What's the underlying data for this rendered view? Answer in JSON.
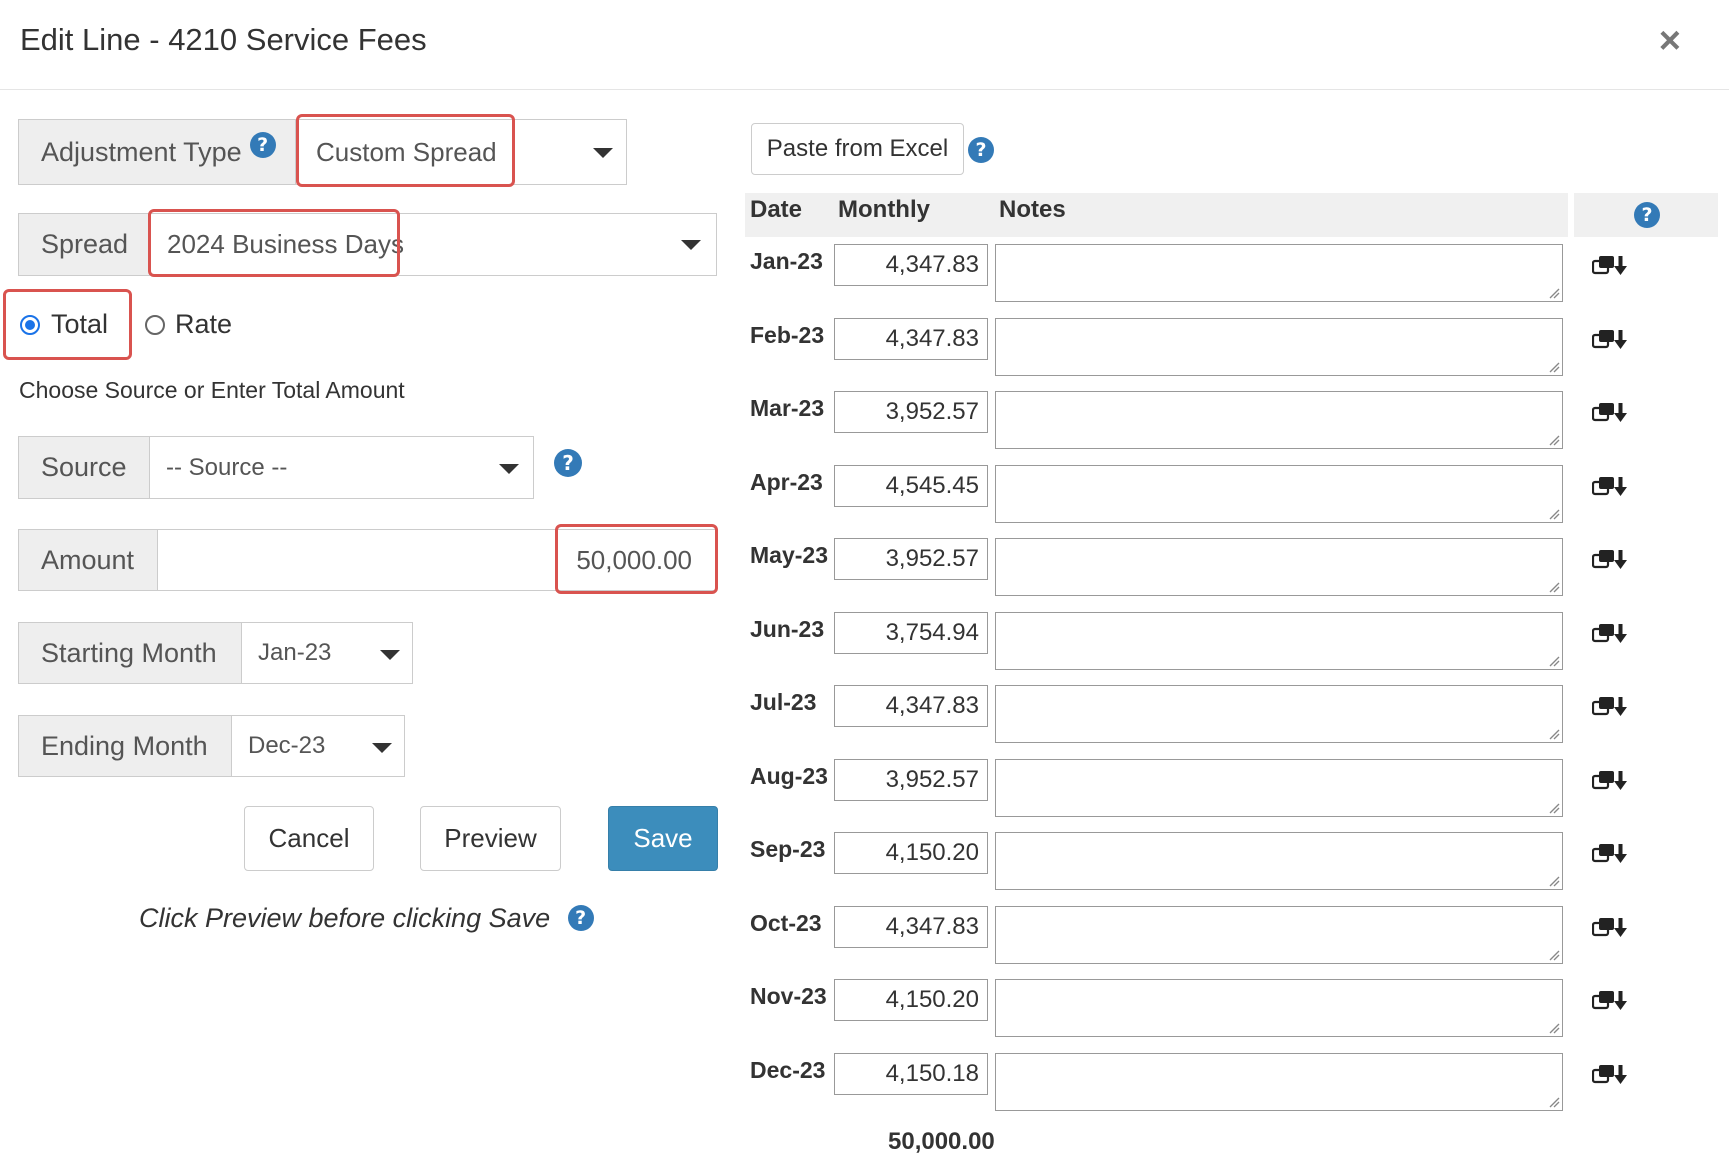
{
  "dialog": {
    "title": "Edit Line - 4210 Service Fees",
    "close": "×"
  },
  "form": {
    "adjustment_type_label": "Adjustment Type",
    "adjustment_type_value": "Custom Spread",
    "spread_label": "Spread",
    "spread_value": "2024 Business Days",
    "radio_total": "Total",
    "radio_rate": "Rate",
    "selected_mode": "Total",
    "hint": "Choose Source or Enter Total Amount",
    "source_label": "Source",
    "source_value": "-- Source --",
    "amount_label": "Amount",
    "amount_value": "50,000.00",
    "starting_month_label": "Starting Month",
    "starting_month_value": "Jan-23",
    "ending_month_label": "Ending Month",
    "ending_month_value": "Dec-23",
    "cancel": "Cancel",
    "preview": "Preview",
    "save": "Save",
    "note": "Click Preview before clicking Save"
  },
  "help_glyph": "?",
  "table": {
    "paste_button": "Paste from Excel",
    "headers": {
      "date": "Date",
      "monthly": "Monthly",
      "notes": "Notes"
    },
    "rows": [
      {
        "date": "Jan-23",
        "monthly": "4,347.83",
        "notes": ""
      },
      {
        "date": "Feb-23",
        "monthly": "4,347.83",
        "notes": ""
      },
      {
        "date": "Mar-23",
        "monthly": "3,952.57",
        "notes": ""
      },
      {
        "date": "Apr-23",
        "monthly": "4,545.45",
        "notes": ""
      },
      {
        "date": "May-23",
        "monthly": "3,952.57",
        "notes": ""
      },
      {
        "date": "Jun-23",
        "monthly": "3,754.94",
        "notes": ""
      },
      {
        "date": "Jul-23",
        "monthly": "4,347.83",
        "notes": ""
      },
      {
        "date": "Aug-23",
        "monthly": "3,952.57",
        "notes": ""
      },
      {
        "date": "Sep-23",
        "monthly": "4,150.20",
        "notes": ""
      },
      {
        "date": "Oct-23",
        "monthly": "4,347.83",
        "notes": ""
      },
      {
        "date": "Nov-23",
        "monthly": "4,150.20",
        "notes": ""
      },
      {
        "date": "Dec-23",
        "monthly": "4,150.18",
        "notes": ""
      }
    ],
    "total": "50,000.00"
  },
  "colors": {
    "primary": "#3c8dbc",
    "help": "#337ab7",
    "highlight": "#d9534f",
    "radio": "#1a73e8"
  },
  "icons": {
    "close": "close-icon",
    "help": "help-icon",
    "copy_down": "copy-down-icon",
    "dropdown": "caret-down-icon"
  }
}
